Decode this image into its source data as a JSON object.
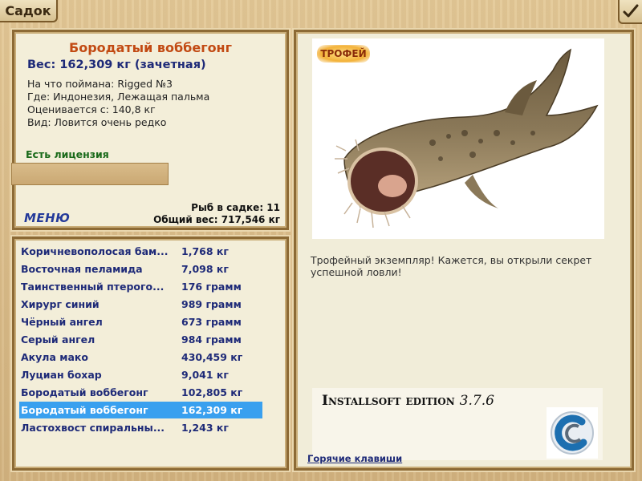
{
  "window": {
    "title": "Садок"
  },
  "catch": {
    "name": "Бородатый воббегонг",
    "weight_line": "Вес: 162,309 кг (зачетная)",
    "bait": "На что поймана: Rigged №3",
    "location": "Где: Индонезия, Лежащая пальма",
    "value": "Оценивается с: 140,8 кг",
    "rarity": "Вид: Ловится очень редко",
    "license": "Есть лицензия",
    "trophy_badge": "ТРОФЕЙ",
    "trophy_text": "Трофейный экземпляр! Кажется, вы открыли секрет успешной ловли!"
  },
  "summary": {
    "fish_count": "Рыб в садке: 11",
    "total_weight": "Общий вес: 717,546 кг"
  },
  "menu_label": "МЕНЮ",
  "fish_list": [
    {
      "name": "Коричневополосая бам...",
      "weight": "1,768 кг"
    },
    {
      "name": "Восточная пеламида",
      "weight": "7,098 кг"
    },
    {
      "name": "Таинственный птерого...",
      "weight": "176 грамм"
    },
    {
      "name": "Хирург синий",
      "weight": "989 грамм"
    },
    {
      "name": "Чёрный ангел",
      "weight": "673 грамм"
    },
    {
      "name": "Серый ангел",
      "weight": "984 грамм"
    },
    {
      "name": "Акула мако",
      "weight": "430,459 кг"
    },
    {
      "name": "Луциан бохар",
      "weight": "9,041 кг"
    },
    {
      "name": "Бородатый воббегонг",
      "weight": "102,805 кг"
    },
    {
      "name": "Бородатый воббегонг",
      "weight": "162,309 кг",
      "selected": true
    },
    {
      "name": "Ластохвост спиральны...",
      "weight": "1,243 кг"
    }
  ],
  "ad": {
    "title": "Installsoft edition",
    "version": "3.7.6"
  },
  "hotkeys_label": "Горячие клавиши",
  "colors": {
    "selected_row": "#39a0ef",
    "fish_name": "#c24a13",
    "list_text": "#1e2a78"
  }
}
